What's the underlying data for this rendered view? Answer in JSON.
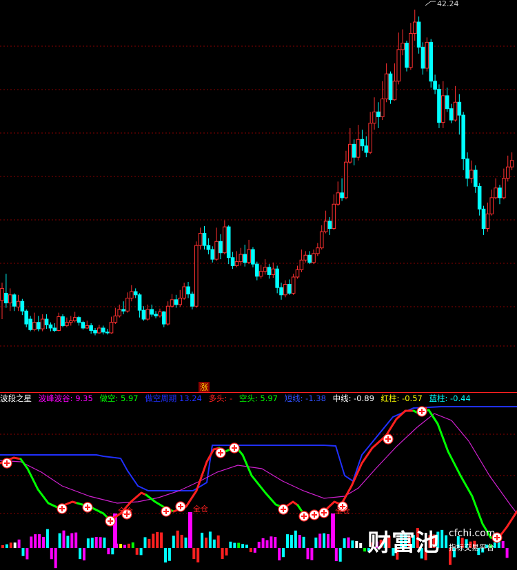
{
  "chart_data": [
    {
      "type": "candlestick",
      "title": "",
      "annotations": {
        "peak_label": "42.24"
      },
      "candles": [
        [
          1,
          6.3,
          7.8,
          8.5,
          4.0
        ],
        [
          2,
          7.2,
          6.0,
          9.6,
          5.4
        ],
        [
          3,
          6.0,
          7.0,
          7.8,
          5.0
        ],
        [
          4,
          7.0,
          5.6,
          7.2,
          5.0
        ],
        [
          5,
          5.5,
          6.2,
          7.0,
          5.0
        ],
        [
          6,
          6.2,
          5.0,
          6.5,
          4.5
        ],
        [
          7,
          5.0,
          3.4,
          5.2,
          3.0
        ],
        [
          8,
          4.0,
          2.7,
          4.4,
          2.5
        ],
        [
          9,
          2.7,
          3.6,
          4.8,
          2.5
        ],
        [
          10,
          3.6,
          2.8,
          4.4,
          2.5
        ],
        [
          11,
          2.8,
          4.0,
          4.6,
          2.5
        ],
        [
          12,
          4.0,
          3.3,
          4.6,
          2.8
        ],
        [
          13,
          3.3,
          2.9,
          3.6,
          2.5
        ],
        [
          14,
          2.9,
          2.6,
          3.5,
          2.4
        ],
        [
          15,
          2.6,
          4.3,
          4.8,
          2.5
        ],
        [
          16,
          4.3,
          3.2,
          4.6,
          3.0
        ],
        [
          17,
          3.2,
          3.6,
          4.2,
          3.0
        ],
        [
          18,
          3.6,
          3.8,
          4.4,
          3.2
        ],
        [
          19,
          3.8,
          4.2,
          4.9,
          3.6
        ],
        [
          20,
          4.2,
          3.6,
          4.4,
          3.2
        ],
        [
          21,
          3.6,
          2.9,
          3.8,
          2.7
        ],
        [
          22,
          2.9,
          3.2,
          3.8,
          2.8
        ],
        [
          23,
          3.2,
          2.6,
          3.5,
          2.2
        ],
        [
          24,
          2.6,
          2.3,
          2.9,
          2.0
        ],
        [
          25,
          2.3,
          2.9,
          3.3,
          2.2
        ],
        [
          26,
          2.9,
          2.4,
          3.2,
          2.1
        ],
        [
          27,
          2.4,
          2.3,
          2.8,
          2.1
        ],
        [
          28,
          2.3,
          3.6,
          4.3,
          2.2
        ],
        [
          29,
          3.6,
          4.4,
          5.4,
          3.4
        ],
        [
          30,
          4.4,
          5.2,
          5.8,
          4.2
        ],
        [
          31,
          5.2,
          5.0,
          6.2,
          4.6
        ],
        [
          32,
          5.0,
          6.6,
          7.3,
          4.8
        ],
        [
          33,
          6.6,
          7.4,
          8.2,
          6.2
        ],
        [
          34,
          7.4,
          7.0,
          7.8,
          6.6
        ],
        [
          35,
          7.0,
          5.1,
          7.2,
          4.2
        ],
        [
          36,
          5.1,
          4.0,
          5.6,
          3.8
        ],
        [
          37,
          4.0,
          5.2,
          5.8,
          3.8
        ],
        [
          38,
          5.2,
          4.6,
          5.8,
          4.3
        ],
        [
          39,
          4.6,
          4.4,
          5.0,
          4.1
        ],
        [
          40,
          4.4,
          4.9,
          5.3,
          4.2
        ],
        [
          41,
          4.9,
          3.4,
          5.0,
          3.0
        ],
        [
          42,
          3.4,
          5.6,
          6.2,
          3.2
        ],
        [
          43,
          5.6,
          6.4,
          7.1,
          5.4
        ],
        [
          44,
          6.4,
          5.8,
          7.0,
          5.4
        ],
        [
          45,
          5.8,
          6.6,
          7.6,
          5.5
        ],
        [
          46,
          6.6,
          8.0,
          8.5,
          6.4
        ],
        [
          47,
          8.0,
          7.1,
          8.6,
          6.6
        ],
        [
          48,
          7.1,
          5.6,
          7.4,
          5.2
        ],
        [
          49,
          5.6,
          13.1,
          13.6,
          5.4
        ],
        [
          50,
          13.1,
          14.6,
          15.3,
          12.6
        ],
        [
          51,
          14.6,
          13.1,
          15.5,
          12.6
        ],
        [
          52,
          13.1,
          12.6,
          14.0,
          12.0
        ],
        [
          53,
          12.6,
          11.4,
          13.0,
          11.0
        ],
        [
          54,
          11.4,
          13.6,
          15.3,
          11.2
        ],
        [
          55,
          13.6,
          12.2,
          14.5,
          11.4
        ],
        [
          56,
          12.2,
          15.4,
          16.2,
          12.0
        ],
        [
          57,
          15.4,
          11.6,
          15.6,
          10.8
        ],
        [
          58,
          11.6,
          10.6,
          12.3,
          10.2
        ],
        [
          59,
          10.6,
          11.1,
          12.4,
          10.4
        ],
        [
          60,
          11.1,
          12.0,
          12.8,
          10.6
        ],
        [
          61,
          12.0,
          11.0,
          13.2,
          10.5
        ],
        [
          62,
          11.0,
          12.6,
          13.8,
          10.8
        ],
        [
          63,
          12.6,
          10.8,
          12.9,
          10.4
        ],
        [
          64,
          10.8,
          9.3,
          11.1,
          8.8
        ],
        [
          65,
          9.3,
          9.9,
          10.7,
          9.0
        ],
        [
          66,
          9.9,
          10.4,
          11.4,
          9.5
        ],
        [
          67,
          10.4,
          9.5,
          10.8,
          9.0
        ],
        [
          68,
          9.5,
          10.2,
          11.0,
          9.1
        ],
        [
          69,
          10.2,
          7.9,
          10.6,
          7.2
        ],
        [
          70,
          7.9,
          7.0,
          8.5,
          6.4
        ],
        [
          71,
          7.0,
          8.3,
          8.8,
          6.7
        ],
        [
          72,
          8.3,
          7.2,
          8.9,
          7.0
        ],
        [
          73,
          7.2,
          9.2,
          9.6,
          7.0
        ],
        [
          74,
          9.2,
          10.1,
          10.6,
          9.0
        ],
        [
          75,
          10.1,
          11.3,
          12.6,
          9.8
        ],
        [
          76,
          11.3,
          11.9,
          12.4,
          11.0
        ],
        [
          77,
          11.9,
          11.0,
          12.4,
          10.8
        ],
        [
          78,
          11.0,
          12.1,
          12.6,
          10.8
        ],
        [
          79,
          12.1,
          12.8,
          13.4,
          11.8
        ],
        [
          80,
          12.8,
          14.8,
          15.6,
          12.6
        ],
        [
          81,
          14.8,
          16.1,
          17.4,
          14.6
        ],
        [
          82,
          16.1,
          15.2,
          16.6,
          14.4
        ],
        [
          83,
          15.2,
          18.2,
          19.4,
          15.0
        ],
        [
          84,
          18.2,
          19.6,
          21.0,
          18.0
        ],
        [
          85,
          19.6,
          19.0,
          21.4,
          18.6
        ],
        [
          86,
          19.0,
          23.4,
          24.8,
          18.8
        ],
        [
          87,
          23.4,
          25.6,
          27.6,
          23.2
        ],
        [
          88,
          25.6,
          24.0,
          26.2,
          23.0
        ],
        [
          89,
          24.0,
          26.2,
          28.0,
          23.6
        ],
        [
          90,
          26.2,
          25.4,
          27.4,
          24.8
        ],
        [
          91,
          25.4,
          24.6,
          26.6,
          24.0
        ],
        [
          92,
          24.6,
          28.2,
          29.6,
          24.4
        ],
        [
          93,
          28.2,
          29.6,
          31.4,
          27.4
        ],
        [
          94,
          29.6,
          29.0,
          30.8,
          27.6
        ],
        [
          95,
          29.0,
          31.2,
          33.4,
          28.6
        ],
        [
          96,
          31.2,
          34.3,
          35.6,
          30.8
        ],
        [
          97,
          34.3,
          31.1,
          34.6,
          30.6
        ],
        [
          98,
          31.1,
          33.4,
          35.6,
          31.0
        ],
        [
          99,
          33.4,
          37.3,
          39.4,
          33.0
        ],
        [
          100,
          37.3,
          38.1,
          39.8,
          36.6
        ],
        [
          101,
          38.1,
          35.1,
          38.4,
          34.6
        ],
        [
          102,
          35.1,
          39.3,
          40.6,
          34.8
        ],
        [
          103,
          39.3,
          40.7,
          42.24,
          38.4
        ],
        [
          104,
          40.7,
          37.6,
          41.4,
          36.8
        ],
        [
          105,
          37.6,
          35.0,
          38.2,
          34.2
        ],
        [
          106,
          35.0,
          38.2,
          38.8,
          34.6
        ],
        [
          107,
          38.2,
          33.4,
          38.6,
          32.6
        ],
        [
          108,
          33.4,
          32.4,
          34.2,
          31.8
        ],
        [
          109,
          32.4,
          28.3,
          33.0,
          27.6
        ],
        [
          110,
          28.3,
          31.6,
          33.4,
          27.6
        ],
        [
          111,
          31.6,
          30.0,
          32.6,
          29.6
        ],
        [
          112,
          30.0,
          28.6,
          30.6,
          28.2
        ],
        [
          113,
          28.6,
          30.8,
          32.8,
          28.4
        ],
        [
          114,
          30.8,
          29.2,
          31.8,
          26.8
        ],
        [
          115,
          29.2,
          23.8,
          29.6,
          22.4
        ],
        [
          116,
          23.8,
          21.4,
          24.6,
          20.4
        ],
        [
          117,
          21.4,
          22.4,
          23.6,
          20.8
        ],
        [
          118,
          22.4,
          20.4,
          23.0,
          19.6
        ],
        [
          119,
          20.4,
          17.6,
          20.8,
          16.8
        ],
        [
          120,
          17.6,
          15.2,
          18.0,
          14.4
        ],
        [
          121,
          15.2,
          17.0,
          18.4,
          14.8
        ],
        [
          122,
          17.0,
          19.0,
          20.0,
          16.8
        ],
        [
          123,
          19.0,
          20.2,
          21.4,
          18.8
        ],
        [
          124,
          20.2,
          19.0,
          20.6,
          18.2
        ],
        [
          125,
          19.0,
          21.4,
          22.6,
          18.8
        ],
        [
          126,
          21.4,
          22.8,
          24.2,
          21.0
        ],
        [
          127,
          22.8,
          23.6,
          24.6,
          22.4
        ]
      ]
    },
    {
      "type": "indicator",
      "title": "波段之星",
      "tag": "涨",
      "labels": {
        "wave": "波峰波谷:",
        "wave_val": "9.35",
        "short": "做空:",
        "short_val": "5.97",
        "cycle": "做空周期",
        "cycle_val": "13.24",
        "long": "多头:",
        "long_val": "-",
        "bear": "空头:",
        "bear_val": "5.97",
        "short_line": "短线:",
        "short_line_val": "-1.38",
        "mid": "中线:",
        "mid_val": "-0.89",
        "red": "红柱:",
        "red_val": "-0.57",
        "blue": "蓝柱:",
        "blue_val": "-0.44"
      },
      "signal_text": "全仓",
      "colors": {
        "wave": "#ff00ff",
        "short": "#00ff00",
        "cycle": "#2030ff",
        "long": "#ff2020",
        "bear": "#00ff00",
        "short_line": "#3050ff",
        "mid": "#ffffff",
        "red": "#ffff00",
        "blue": "#00ffff"
      }
    }
  ],
  "watermark": {
    "brand": "财富池",
    "url": "cfchi.com",
    "sub": "指标交易平台"
  }
}
